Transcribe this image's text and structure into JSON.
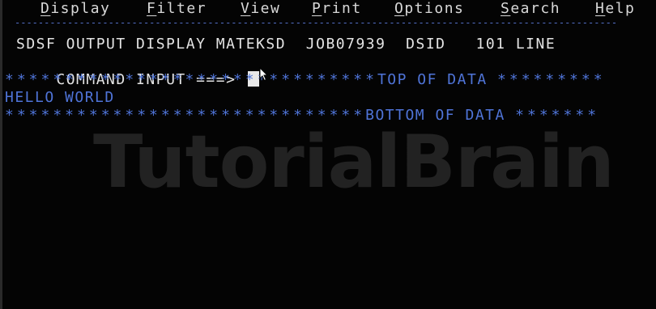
{
  "menu": {
    "items": [
      {
        "hotkey": "D",
        "rest": "isplay"
      },
      {
        "hotkey": "F",
        "rest": "ilter"
      },
      {
        "hotkey": "V",
        "rest": "iew"
      },
      {
        "hotkey": "P",
        "rest": "rint"
      },
      {
        "hotkey": "O",
        "rest": "ptions"
      },
      {
        "hotkey": "S",
        "rest": "earch"
      },
      {
        "hotkey": "H",
        "rest": "elp"
      }
    ],
    "separator": "-------------------------------------------------------------------------------------------------------"
  },
  "header": {
    "title": "SDSF OUTPUT DISPLAY MATEKSD  JOB07939  DSID   101 LINE",
    "command_label": "COMMAND INPUT ===>",
    "command_value": ""
  },
  "data": {
    "top_stars": "*******************************",
    "top_marker": "TOP OF DATA",
    "top_stars_right": "*********",
    "lines": [
      "HELLO WORLD"
    ],
    "bottom_stars": "******************************",
    "bottom_marker": "BOTTOM OF DATA",
    "bottom_stars_right": "*******"
  },
  "watermark": "TutorialBrain",
  "colors": {
    "background": "#040404",
    "text": "#e4e4e4",
    "data_blue": "#4f74d8"
  }
}
